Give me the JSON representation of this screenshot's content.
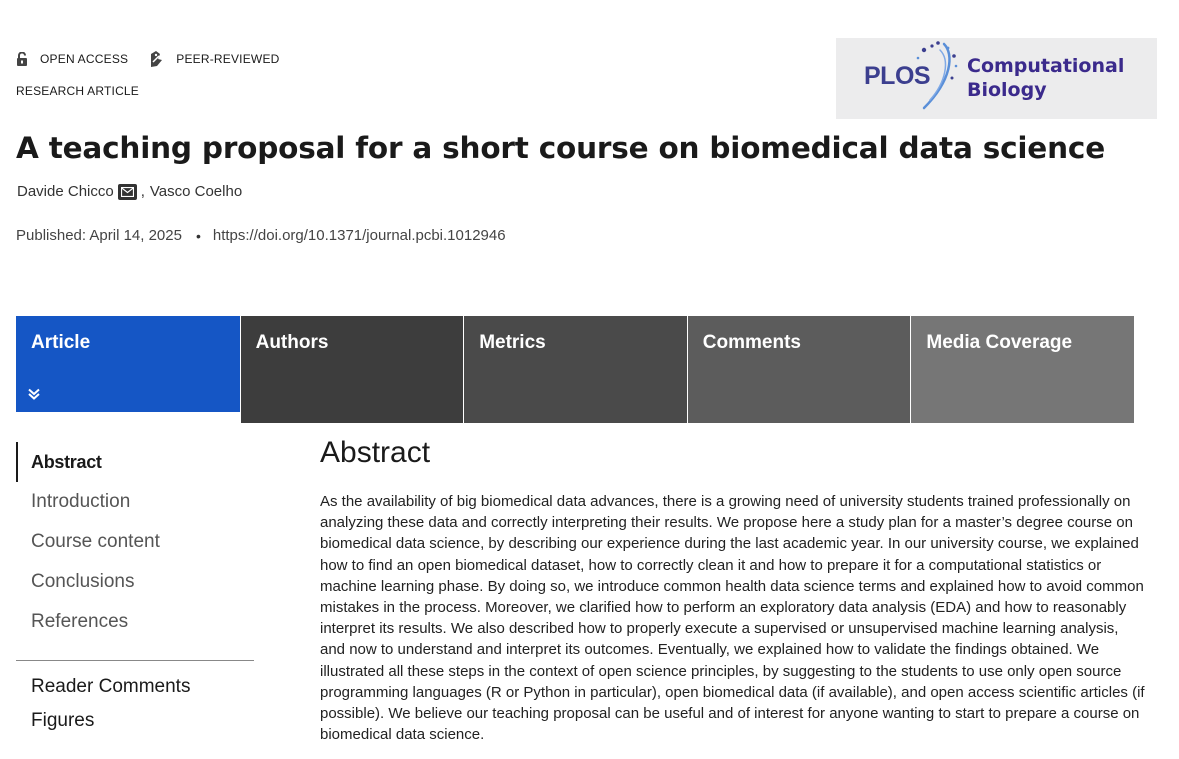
{
  "badges": {
    "open_access": "OPEN ACCESS",
    "peer_reviewed": "PEER-REVIEWED"
  },
  "article_type": "RESEARCH ARTICLE",
  "journal": {
    "publisher": "PLOS",
    "name_line1": "Computational",
    "name_line2": "Biology"
  },
  "title": "A teaching proposal for a short course on biomedical data science",
  "authors": [
    {
      "name": "Davide Chicco"
    },
    {
      "name": "Vasco Coelho"
    }
  ],
  "author_separator": ",",
  "published": "Published: April 14, 2025",
  "bullet": "•",
  "doi": "https://doi.org/10.1371/journal.pcbi.1012946",
  "tabs": [
    {
      "label": "Article",
      "active": true
    },
    {
      "label": "Authors"
    },
    {
      "label": "Metrics"
    },
    {
      "label": "Comments"
    },
    {
      "label": "Media Coverage"
    }
  ],
  "sidenav": {
    "items": [
      "Abstract",
      "Introduction",
      "Course content",
      "Conclusions",
      "References"
    ],
    "extras": [
      "Reader Comments",
      "Figures"
    ]
  },
  "abstract": {
    "heading": "Abstract",
    "text": "As the availability of big biomedical data advances, there is a growing need of university students trained professionally on analyzing these data and correctly interpreting their results. We propose here a study plan for a master’s degree course on biomedical data science, by describing our experience during the last academic year. In our university course, we explained how to find an open biomedical dataset, how to correctly clean it and how to prepare it for a computational statistics or machine learning phase. By doing so, we introduce common health data science terms and explained how to avoid common mistakes in the process. Moreover, we clarified how to perform an exploratory data analysis (EDA) and how to reasonably interpret its results. We also described how to properly execute a supervised or unsupervised machine learning analysis, and now to understand and interpret its outcomes. Eventually, we explained how to validate the findings obtained. We illustrated all these steps in the context of open science principles, by suggesting to the students to use only open source programming languages (R or Python in particular), open biomedical data (if available), and open access scientific articles (if possible). We believe our teaching proposal can be useful and of interest for anyone wanting to start to prepare a course on biomedical data science."
  },
  "colors": {
    "tab_active": "#1556c5",
    "tab_1": "#3d3d3d",
    "tab_2": "#4a4a4a",
    "tab_3": "#5c5c5c",
    "tab_4": "#767676",
    "journal_purple": "#3b2a8c"
  },
  "icons": {
    "open_access": "unlocked-padlock-icon",
    "peer_reviewed": "peer-review-icon",
    "email": "envelope-icon",
    "expand": "double-chevron-down-icon"
  }
}
